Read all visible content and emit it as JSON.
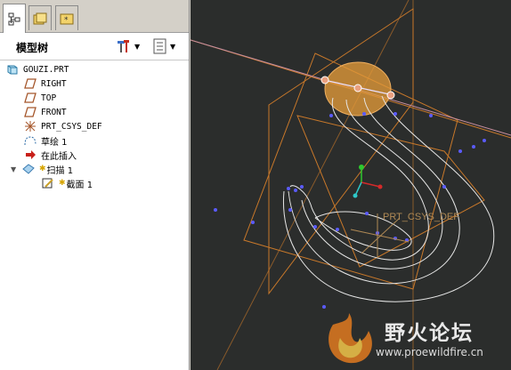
{
  "panel": {
    "tabs": [
      {
        "icon": "model-tree-icon",
        "active": true
      },
      {
        "icon": "folder-browser-icon",
        "active": false
      },
      {
        "icon": "favorites-icon",
        "active": false
      }
    ],
    "title": "模型树"
  },
  "tree": {
    "items": [
      {
        "label": "GOUZI.PRT",
        "icon": "part-icon"
      },
      {
        "label": "RIGHT",
        "icon": "datum-plane-icon"
      },
      {
        "label": "TOP",
        "icon": "datum-plane-icon"
      },
      {
        "label": "FRONT",
        "icon": "datum-plane-icon"
      },
      {
        "label": "PRT_CSYS_DEF",
        "icon": "csys-icon"
      },
      {
        "label": "草绘 1",
        "icon": "sketch-icon"
      },
      {
        "label": "在此插入",
        "icon": "insert-here-arrow-icon"
      },
      {
        "label": "扫描 1",
        "icon": "sweep-icon"
      },
      {
        "label": "截面 1",
        "icon": "section-icon"
      }
    ]
  },
  "viewport": {
    "csys_label": "PRT_CSYS_DEF",
    "watermark_title": "野火论坛",
    "watermark_url": "www.proewildfire.cn"
  },
  "colors": {
    "viewport_bg": "#2b2d2c",
    "datum_plane": "#c8782a",
    "curve": "#e6e6e6",
    "point": "#5b5bff",
    "highlight_fill": "#e39a3a"
  }
}
